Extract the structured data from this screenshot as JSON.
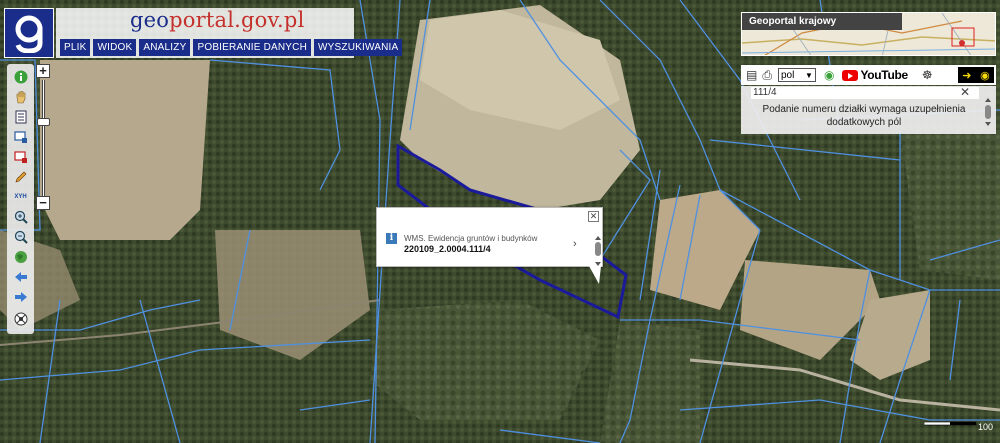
{
  "header": {
    "brand_geo": "geo",
    "brand_rest": "portal.gov.pl",
    "menu": [
      "PLIK",
      "WIDOK",
      "ANALIZY",
      "POBIERANIE DANYCH",
      "WYSZUKIWANIA"
    ]
  },
  "toolbar": {
    "icons": [
      "info-icon",
      "pan-hand-icon",
      "layers-icon",
      "select-add-icon",
      "select-remove-icon",
      "pencil-icon",
      "xyh-icon",
      "zoom-in-icon",
      "zoom-out-icon",
      "globe-icon",
      "back-arrow-icon",
      "forward-arrow-icon",
      "settings-icon"
    ],
    "xyh_label": "XYH"
  },
  "zoom": {
    "plus": "+",
    "minus": "−",
    "level_fraction": 0.35
  },
  "overview": {
    "title": "Geoportal krajowy"
  },
  "right_tools": {
    "language": "pol",
    "youtube": "YouTube"
  },
  "search": {
    "query": "111/4",
    "message": "Podanie numeru działki wymaga uzupełnienia dodatkowych pól"
  },
  "popup": {
    "service": "WMS. Ewidencja gruntów i budynków",
    "parcel_id": "220109_2.0004.111/4"
  },
  "scale": {
    "label": "100"
  },
  "colors": {
    "brand_blue": "#1b2d8a",
    "brand_red": "#c4302b",
    "parcel_lines": "#4f90e0",
    "selected_parcel": "#1a1a9a"
  }
}
